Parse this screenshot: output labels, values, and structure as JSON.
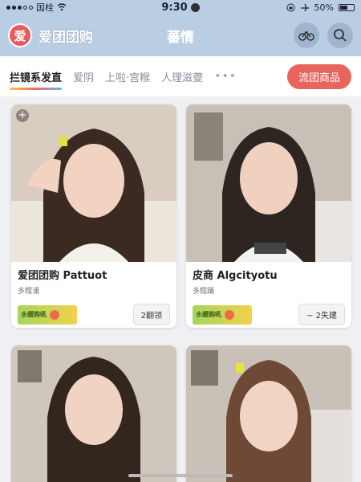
{
  "status": {
    "carrier": "国栓",
    "time": "9:30",
    "battery": "50%"
  },
  "header": {
    "logo_char": "爱",
    "brand": "爱团团购",
    "title": "蕃情"
  },
  "tabs": [
    {
      "label": "拦镜系发直",
      "active": true
    },
    {
      "label": "爱阴",
      "active": false
    },
    {
      "label": "上啦·宫糇",
      "active": false
    },
    {
      "label": "人理滋夔",
      "active": false
    }
  ],
  "more_label": "•••",
  "action_pill": "流团商品",
  "cards": [
    {
      "title": "爱团团购 Pattuot",
      "subtitle": "多糯浦",
      "coupon": "水缓购吼",
      "button": "2翻领",
      "has_plus": true
    },
    {
      "title": "皮商 Algcityotu",
      "subtitle": "多糯踊",
      "coupon": "水缓购吼",
      "button": "~ 2失建",
      "has_plus": false
    },
    {
      "title": "",
      "subtitle": "",
      "coupon": "",
      "button": "",
      "has_plus": false
    },
    {
      "title": "",
      "subtitle": "",
      "coupon": "",
      "button": "",
      "has_plus": false
    }
  ],
  "colors": {
    "header_bg": "#b9cde3",
    "accent": "#e8655f",
    "coupon_green": "#a6d55b",
    "coupon_yellow": "#f2d24b"
  },
  "icons": {
    "header_left": "bike-icon",
    "header_right": "search-icon"
  }
}
